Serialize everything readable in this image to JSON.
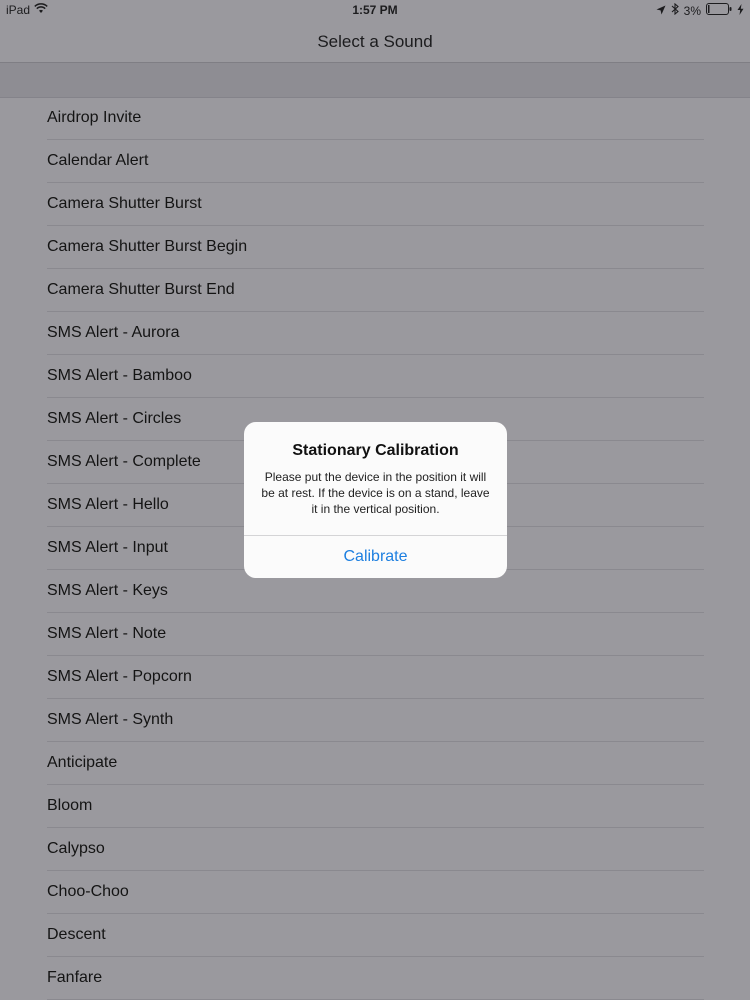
{
  "status_bar": {
    "carrier": "iPad",
    "time": "1:57 PM",
    "battery": "3%",
    "icons": [
      "wifi-icon",
      "location-arrow-icon",
      "bluetooth-icon",
      "battery-icon",
      "charging-bolt-icon"
    ]
  },
  "nav": {
    "title": "Select a Sound"
  },
  "sounds": [
    "Airdrop Invite",
    "Calendar Alert",
    "Camera Shutter Burst",
    "Camera Shutter Burst Begin",
    "Camera Shutter Burst End",
    "SMS Alert - Aurora",
    "SMS Alert - Bamboo",
    "SMS Alert - Circles",
    "SMS Alert - Complete",
    "SMS Alert - Hello",
    "SMS Alert - Input",
    "SMS Alert - Keys",
    "SMS Alert - Note",
    "SMS Alert - Popcorn",
    "SMS Alert - Synth",
    "Anticipate",
    "Bloom",
    "Calypso",
    "Choo-Choo",
    "Descent",
    "Fanfare"
  ],
  "dialog": {
    "title": "Stationary Calibration",
    "message": "Please put the device in the position it will be at rest. If the device is on a stand, leave it in the vertical position.",
    "button_label": "Calibrate"
  },
  "colors": {
    "accent": "#1d7fe0",
    "dim_background": "#9a999e"
  }
}
